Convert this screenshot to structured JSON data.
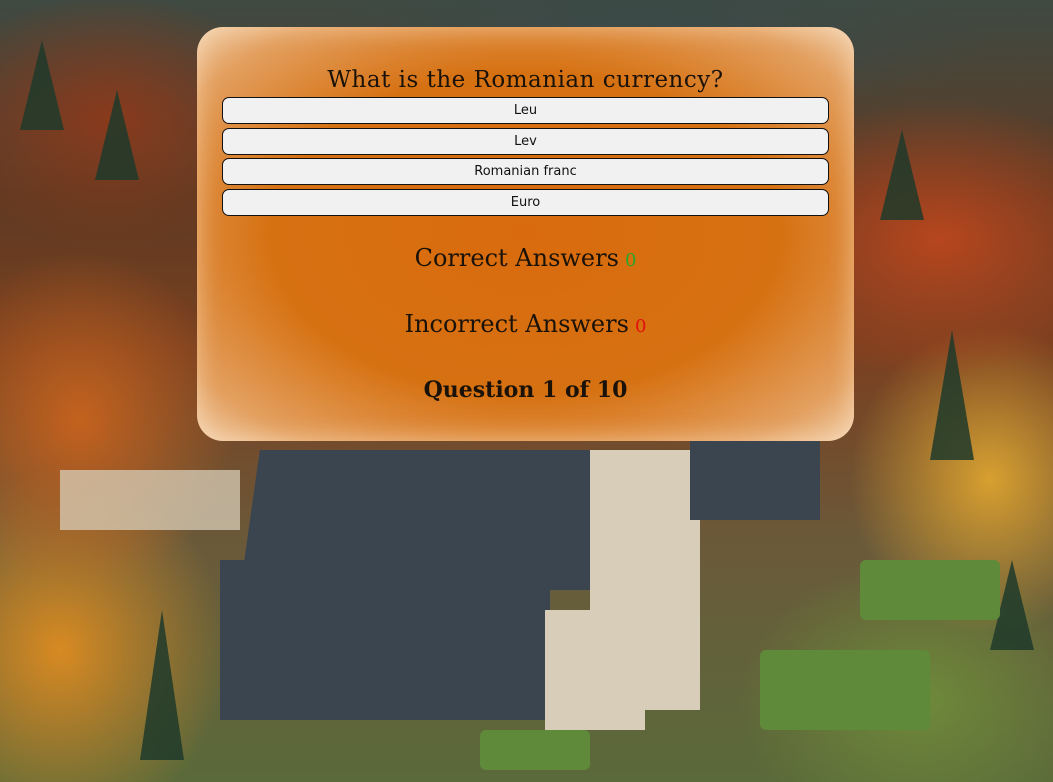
{
  "quiz": {
    "question": "What is the Romanian currency?",
    "answers": [
      "Leu",
      "Lev",
      "Romanian franc",
      "Euro"
    ],
    "correct_label": "Correct Answers",
    "correct_count": "0",
    "incorrect_label": "Incorrect Answers",
    "incorrect_count": "0",
    "progress": "Question 1 of 10"
  },
  "colors": {
    "panel": "#d96b0e",
    "correct": "#2aa52a",
    "incorrect": "#e01010"
  }
}
